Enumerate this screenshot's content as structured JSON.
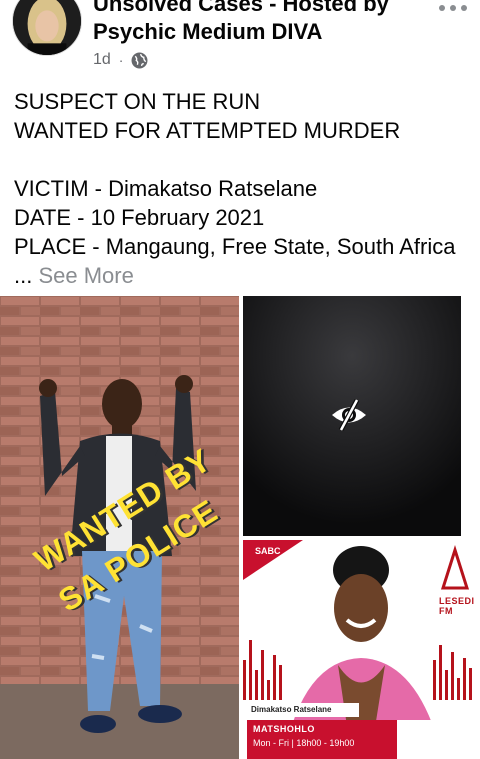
{
  "header": {
    "page_name": "Unsolved Cases - Hosted by Psychic Medium DIVA",
    "time": "1d",
    "separator": "·",
    "privacy_icon": "globe-icon",
    "more_icon": "more-horizontal-icon"
  },
  "post": {
    "text": "SUSPECT ON THE RUN\nWANTED FOR ATTEMPTED MURDER\n\nVICTIM - Dimakatso Ratselane\nDATE - 10 February 2021\nPLACE - Mangaung, Free State, South Africa ...",
    "see_more": "See More"
  },
  "photos": {
    "left": {
      "overlay_line1": "WANTED BY",
      "overlay_line2": "SA POLICE"
    },
    "hidden": {
      "icon": "eye-slash-icon"
    },
    "radio": {
      "sabc_label": "SABC",
      "brand_label": "LESEDI FM",
      "name_label": "Dimakatso Ratselane",
      "show_title": "MATSHOHLO",
      "show_time": "Mon - Fri  |  18h00 - 19h00"
    }
  },
  "colors": {
    "text": "#050505",
    "muted": "#65676b",
    "see_more": "#8a8d91",
    "accent_red": "#c8102e",
    "overlay_yellow": "#ffe234"
  }
}
